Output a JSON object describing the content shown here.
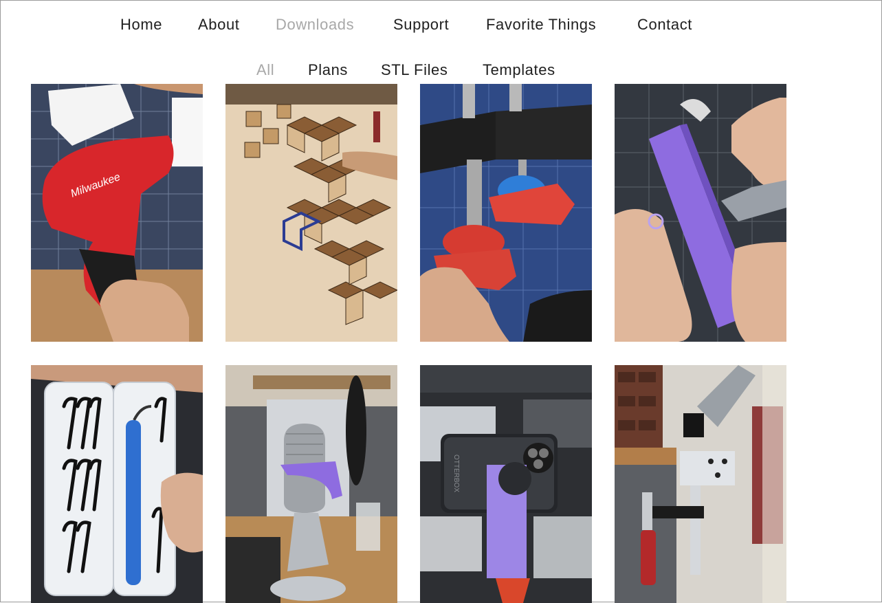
{
  "nav": {
    "items": [
      {
        "label": "Home",
        "active": false
      },
      {
        "label": "About",
        "active": false
      },
      {
        "label": "Downloads",
        "active": true
      },
      {
        "label": "Support",
        "active": false
      },
      {
        "label": "Favorite Things",
        "active": false
      },
      {
        "label": "Contact",
        "active": false
      }
    ]
  },
  "filter": {
    "items": [
      {
        "label": "All",
        "active": true
      },
      {
        "label": "Plans",
        "active": false
      },
      {
        "label": "STL Files",
        "active": false
      },
      {
        "label": "Templates",
        "active": false
      }
    ]
  },
  "gallery": {
    "tiles": [
      {
        "icon": "drill-photo",
        "brand_text": "Milwaukee"
      },
      {
        "icon": "wood-parquet-photo"
      },
      {
        "icon": "clamp-pads-photo"
      },
      {
        "icon": "purple-block-carving-photo"
      },
      {
        "icon": "deburring-tool-case-photo"
      },
      {
        "icon": "microphone-mount-photo"
      },
      {
        "icon": "phone-mount-photo",
        "brand_text": "OTTERBOX"
      },
      {
        "icon": "bench-clamp-photo"
      }
    ]
  },
  "colors": {
    "active_nav": "#a8a8a8",
    "nav_text": "#1f1f1f",
    "drill_red": "#d8262b",
    "print_blue": "#2f7ed8",
    "print_purple": "#8e6ce0",
    "print_red": "#e0453a"
  }
}
